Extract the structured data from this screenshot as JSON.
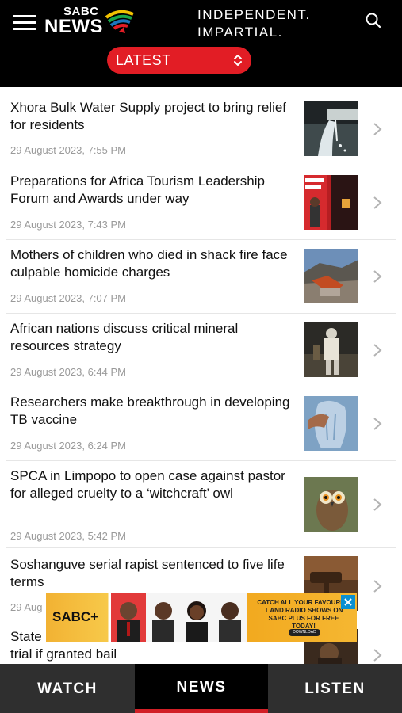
{
  "header": {
    "logo_top": "SABC",
    "logo_main": "NEWS",
    "tagline_line1": "INDEPENDENT.",
    "tagline_line2": "IMPARTIAL.",
    "dropdown_label": "LATEST",
    "accent_color": "#e21d25"
  },
  "articles": [
    {
      "title": "Xhora Bulk Water Supply project to bring relief for residents",
      "date": "29 August 2023, 7:55 PM"
    },
    {
      "title": "Preparations for Africa Tourism Leadership Forum and Awards under way",
      "date": "29 August 2023, 7:43 PM"
    },
    {
      "title": "Mothers of children who died in shack fire face culpable homicide charges",
      "date": "29 August 2023, 7:07 PM"
    },
    {
      "title": "African nations discuss critical mineral resources strategy",
      "date": "29 August 2023, 6:44 PM"
    },
    {
      "title": "Researchers make breakthrough in developing TB vaccine",
      "date": "29 August 2023, 6:24 PM"
    },
    {
      "title": "SPCA in Limpopo to open case against pastor for alleged cruelty to a ‘witchcraft’ owl",
      "date": "29 August 2023, 5:42 PM"
    },
    {
      "title": "Soshanguve serial rapist sentenced to five life terms",
      "date": "29 Aug"
    },
    {
      "title": "State",
      "title_line2": "trial if granted bail"
    }
  ],
  "ad": {
    "brand": "SABC+",
    "headline": "CATCH ALL YOUR FAVOURITE T AND RADIO SHOWS ON SABC PLUS FOR FREE TODAY!",
    "button": "DOWNLOAD"
  },
  "tabs": {
    "watch": "WATCH",
    "news": "NEWS",
    "listen": "LISTEN"
  },
  "icons": {
    "menu": "hamburger-icon",
    "search": "search-icon",
    "dropdown": "up-down-arrows-icon",
    "row_chevron": "chevron-right-icon",
    "ad_close": "close-icon"
  }
}
